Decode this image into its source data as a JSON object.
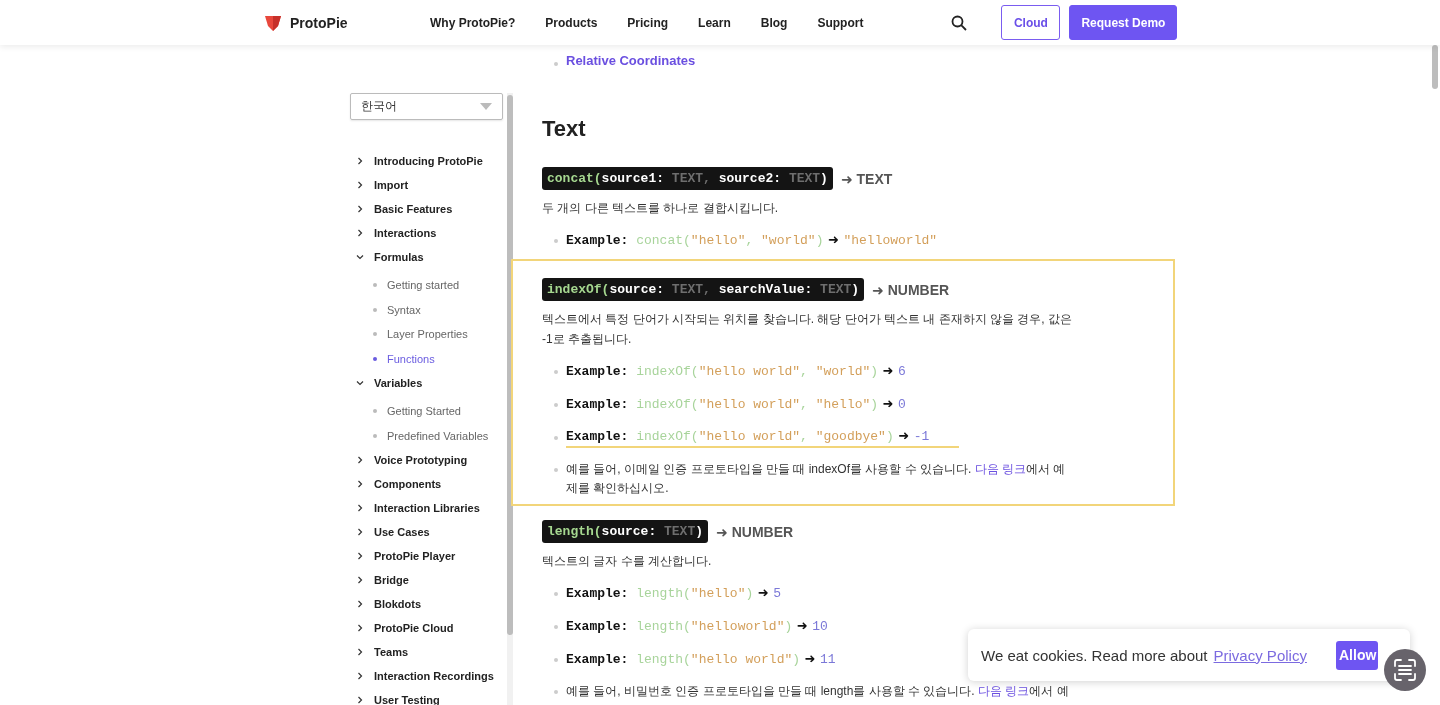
{
  "header": {
    "brand": "ProtoPie",
    "nav": [
      "Why ProtoPie?",
      "Products",
      "Pricing",
      "Learn",
      "Blog",
      "Support"
    ],
    "buttons": [
      {
        "label": "Cloud",
        "kind": "outline"
      },
      {
        "label": "Request Demo",
        "kind": "primary"
      }
    ]
  },
  "sidebar": {
    "language": "한국어",
    "items": [
      {
        "label": "Introducing ProtoPie",
        "expanded": false
      },
      {
        "label": "Import",
        "expanded": false
      },
      {
        "label": "Basic Features",
        "expanded": false
      },
      {
        "label": "Interactions",
        "expanded": false
      },
      {
        "label": "Formulas",
        "expanded": true,
        "children": [
          {
            "label": "Getting started",
            "selected": false
          },
          {
            "label": "Syntax",
            "selected": false
          },
          {
            "label": "Layer Properties",
            "selected": false
          },
          {
            "label": "Functions",
            "selected": true
          }
        ]
      },
      {
        "label": "Variables",
        "expanded": true,
        "children": [
          {
            "label": "Getting Started",
            "selected": false
          },
          {
            "label": "Predefined Variables",
            "selected": false
          }
        ]
      },
      {
        "label": "Voice Prototyping",
        "expanded": false
      },
      {
        "label": "Components",
        "expanded": false
      },
      {
        "label": "Interaction Libraries",
        "expanded": false
      },
      {
        "label": "Use Cases",
        "expanded": false
      },
      {
        "label": "ProtoPie Player",
        "expanded": false
      },
      {
        "label": "Bridge",
        "expanded": false
      },
      {
        "label": "Blokdots",
        "expanded": false
      },
      {
        "label": "ProtoPie Cloud",
        "expanded": false
      },
      {
        "label": "Teams",
        "expanded": false
      },
      {
        "label": "Interaction Recordings",
        "expanded": false
      },
      {
        "label": "User Testing",
        "expanded": false
      }
    ]
  },
  "content": {
    "top_link": "Relative Coordinates",
    "heading": "Text",
    "functions": [
      {
        "name": "concat(",
        "params": [
          {
            "name": "source1:",
            "type": "TEXT"
          },
          {
            "name": "source2:",
            "type": "TEXT"
          }
        ],
        "sep": ",",
        "close": ")",
        "returns": "➜ TEXT",
        "highlighted": false,
        "description": "두 개의 다른 텍스트를 하나로 결합시킵니다.",
        "examples": [
          {
            "label": "Example:",
            "underlined": false,
            "tokens": [
              {
                "kind": "code",
                "text": "concat("
              },
              {
                "kind": "str",
                "text": "\"hello\""
              },
              {
                "kind": "code",
                "text": ", "
              },
              {
                "kind": "str",
                "text": "\"world\""
              },
              {
                "kind": "code",
                "text": ")"
              },
              {
                "kind": "arrow",
                "text": " ➜ "
              },
              {
                "kind": "str",
                "text": "\"helloworld\""
              }
            ]
          }
        ]
      },
      {
        "name": "indexOf(",
        "params": [
          {
            "name": "source:",
            "type": "TEXT"
          },
          {
            "name": "searchValue:",
            "type": "TEXT"
          }
        ],
        "sep": ",",
        "close": ")",
        "returns": "➜ NUMBER",
        "highlighted": true,
        "description": "텍스트에서 특정 단어가 시작되는 위치를 찾습니다. 해당 단어가 텍스트 내 존재하지 않을 경우, 값은 -1로 추출됩니다.",
        "examples": [
          {
            "label": "Example:",
            "underlined": false,
            "tokens": [
              {
                "kind": "code",
                "text": "indexOf("
              },
              {
                "kind": "str",
                "text": "\"hello world\""
              },
              {
                "kind": "code",
                "text": ", "
              },
              {
                "kind": "str",
                "text": "\"world\""
              },
              {
                "kind": "code",
                "text": ")"
              },
              {
                "kind": "arrow",
                "text": " ➜ "
              },
              {
                "kind": "num",
                "text": "6"
              }
            ]
          },
          {
            "label": "Example:",
            "underlined": false,
            "tokens": [
              {
                "kind": "code",
                "text": "indexOf("
              },
              {
                "kind": "str",
                "text": "\"hello world\""
              },
              {
                "kind": "code",
                "text": ", "
              },
              {
                "kind": "str",
                "text": "\"hello\""
              },
              {
                "kind": "code",
                "text": ")"
              },
              {
                "kind": "arrow",
                "text": " ➜ "
              },
              {
                "kind": "num",
                "text": "0"
              }
            ]
          },
          {
            "label": "Example:",
            "underlined": true,
            "tokens": [
              {
                "kind": "code",
                "text": "indexOf("
              },
              {
                "kind": "str",
                "text": "\"hello world\""
              },
              {
                "kind": "code",
                "text": ", "
              },
              {
                "kind": "str",
                "text": "\"goodbye\""
              },
              {
                "kind": "code",
                "text": ")"
              },
              {
                "kind": "arrow",
                "text": " ➜ "
              },
              {
                "kind": "num",
                "text": "-1"
              }
            ]
          }
        ],
        "note": {
          "before": "예를 들어, 이메일 인증 프로토타입을 만들 때 indexOf를 사용할 수 있습니다. ",
          "link": "다음 링크",
          "after": "에서 예제를 확인하십시오."
        }
      },
      {
        "name": "length(",
        "params": [
          {
            "name": "source:",
            "type": "TEXT"
          }
        ],
        "close": ")",
        "returns": "➜ NUMBER",
        "highlighted": false,
        "description": "텍스트의 글자 수를 계산합니다.",
        "examples": [
          {
            "label": "Example:",
            "underlined": false,
            "tokens": [
              {
                "kind": "code",
                "text": "length("
              },
              {
                "kind": "str",
                "text": "\"hello\""
              },
              {
                "kind": "code",
                "text": ")"
              },
              {
                "kind": "arrow",
                "text": " ➜ "
              },
              {
                "kind": "num",
                "text": "5"
              }
            ]
          },
          {
            "label": "Example:",
            "underlined": false,
            "tokens": [
              {
                "kind": "code",
                "text": "length("
              },
              {
                "kind": "str",
                "text": "\"helloworld\""
              },
              {
                "kind": "code",
                "text": ")"
              },
              {
                "kind": "arrow",
                "text": " ➜ "
              },
              {
                "kind": "num",
                "text": "10"
              }
            ]
          },
          {
            "label": "Example:",
            "underlined": false,
            "tokens": [
              {
                "kind": "code",
                "text": "length("
              },
              {
                "kind": "str",
                "text": "\"hello world\""
              },
              {
                "kind": "code",
                "text": ")"
              },
              {
                "kind": "arrow",
                "text": " ➜ "
              },
              {
                "kind": "num",
                "text": "11"
              }
            ]
          }
        ],
        "note": {
          "before": "예를 들어, 비밀번호 인증 프로토타입을 만들 때 length를 사용할 수 있습니다. ",
          "link": "다음 링크",
          "after": "에서 예"
        }
      }
    ]
  },
  "cookie": {
    "text": "We eat cookies. Read more about",
    "link": "Privacy Policy",
    "button": "Allow"
  }
}
